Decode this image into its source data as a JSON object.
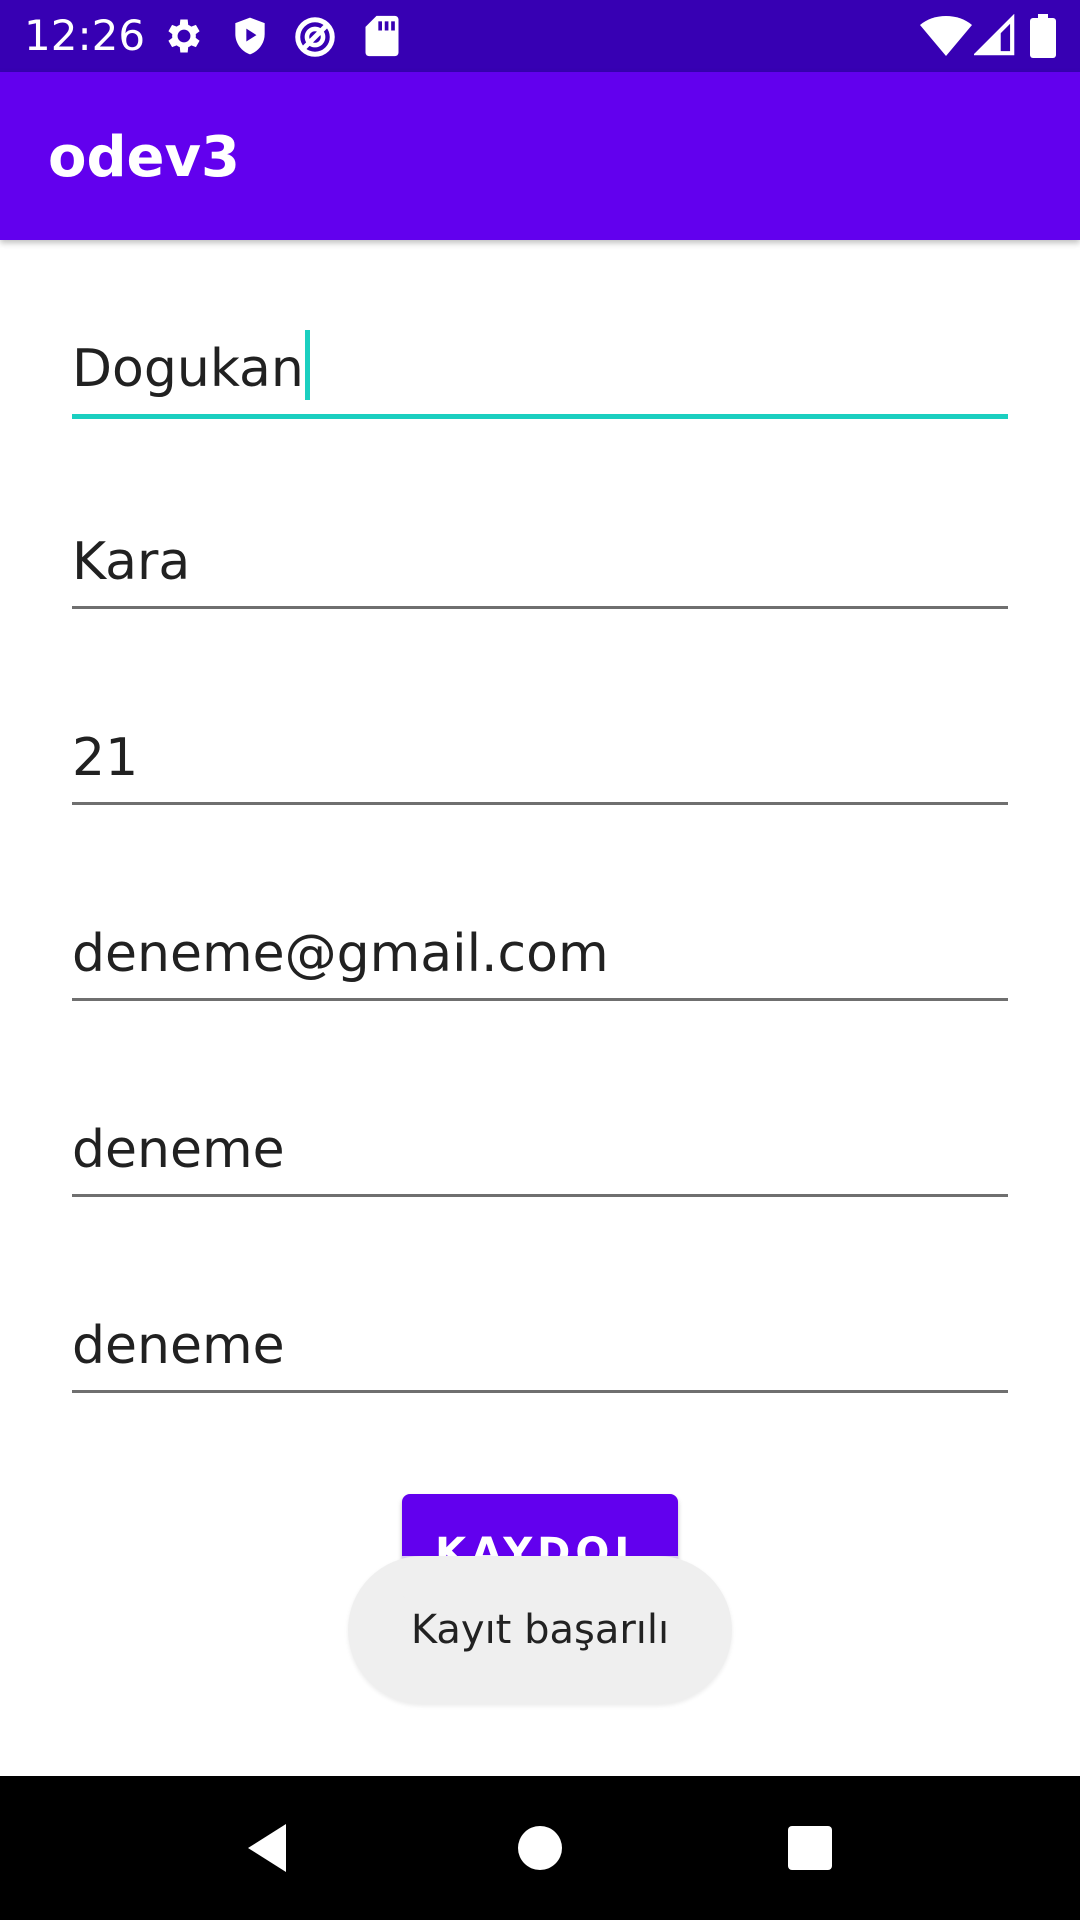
{
  "status_bar": {
    "time": "12:26",
    "icons_left": [
      "settings-icon",
      "shield-icon",
      "sync-icon",
      "sd-card-icon"
    ],
    "icons_right": [
      "wifi-icon",
      "signal-icon",
      "battery-icon"
    ]
  },
  "app_bar": {
    "title": "odev3",
    "color": "#6200ee"
  },
  "form": {
    "fields": [
      {
        "name": "first-name-field",
        "value": "Dogukan",
        "focused": true
      },
      {
        "name": "last-name-field",
        "value": "Kara",
        "focused": false
      },
      {
        "name": "age-field",
        "value": "21",
        "focused": false
      },
      {
        "name": "email-field",
        "value": "deneme@gmail.com",
        "focused": false
      },
      {
        "name": "username-field",
        "value": "deneme",
        "focused": false
      },
      {
        "name": "password-field",
        "value": "deneme",
        "focused": false
      }
    ],
    "submit_label": "KAYDOL"
  },
  "toast": {
    "message": "Kayıt başarılı"
  },
  "nav_bar": {
    "icons": [
      "back-icon",
      "home-icon",
      "recents-icon"
    ]
  },
  "colors": {
    "status_bar": "#3700b3",
    "primary": "#6200ee",
    "focus_accent": "#1bcfc0"
  }
}
